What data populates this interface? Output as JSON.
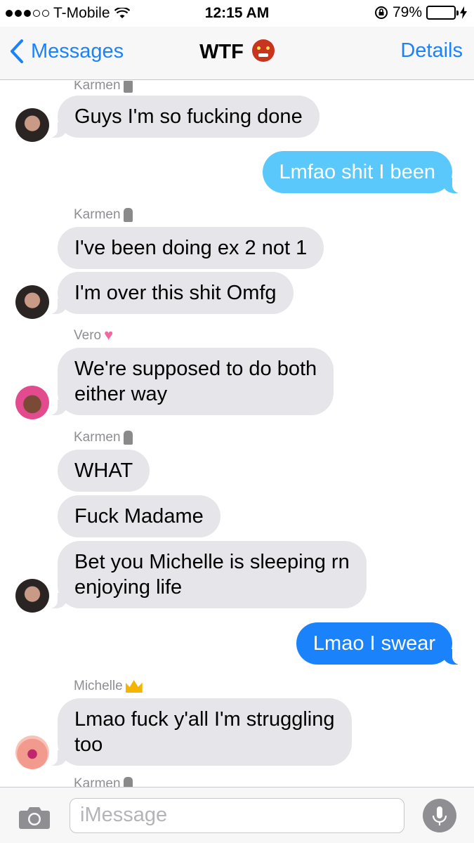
{
  "status_bar": {
    "carrier": "T-Mobile",
    "time": "12:15 AM",
    "battery_percent": "79%",
    "battery_level": 0.79,
    "signal_bars": 3
  },
  "nav": {
    "back_label": "Messages",
    "title": "WTF",
    "title_emoji": "ogre-emoji",
    "details_label": "Details"
  },
  "senders": {
    "karmen": "Karmen",
    "vero": "Vero",
    "michelle": "Michelle"
  },
  "messages": [
    {
      "from": "Karmen",
      "text": "Guys I'm so fucking done"
    },
    {
      "from": "me",
      "text": "Lmfao shit I been"
    },
    {
      "from": "Karmen",
      "text": "I've been doing ex 2 not 1"
    },
    {
      "from": "Karmen",
      "text": "I'm over this shit Omfg"
    },
    {
      "from": "Vero",
      "text": "We're supposed to do both either way",
      "line1": "We're supposed to do both",
      "line2": "either way"
    },
    {
      "from": "Karmen",
      "text": "WHAT"
    },
    {
      "from": "Karmen",
      "text": "Fuck Madame"
    },
    {
      "from": "Karmen",
      "text": "Bet you Michelle is sleeping rn enjoying life",
      "line1": "Bet you Michelle is sleeping rn",
      "line2": "enjoying life"
    },
    {
      "from": "me",
      "text": "Lmao I swear"
    },
    {
      "from": "Michelle",
      "text": "Lmao fuck y'all I'm struggling too",
      "line1": "Lmao fuck y'all I'm struggling",
      "line2": "too"
    }
  ],
  "input": {
    "placeholder": "iMessage"
  },
  "colors": {
    "accent": "#1a82fb",
    "incoming_bubble": "#e5e5ea",
    "outgoing_sms": "#5ac8fa",
    "outgoing_imessage": "#1a82fb"
  }
}
